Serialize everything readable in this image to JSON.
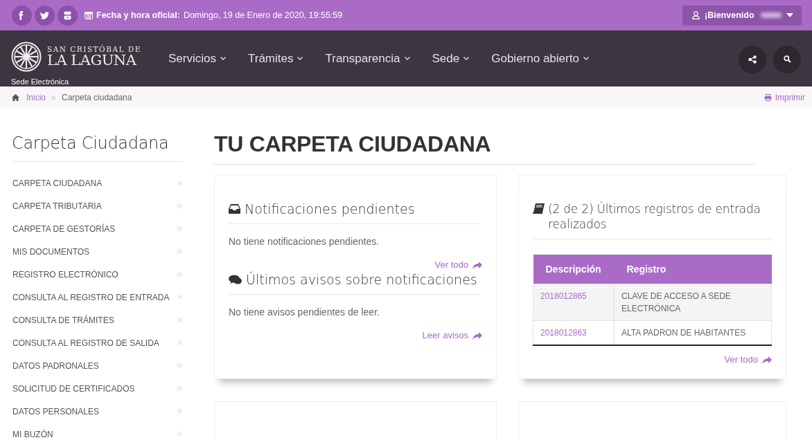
{
  "top_bar": {
    "date_label": "Fecha y hora oficial:",
    "date_value": "Domingo, 19 de Enero de 2020, 19:55:59",
    "user_button": "¡Bienvenido"
  },
  "header": {
    "logo_line_1": "SAN CRISTÓBAL DE",
    "logo_line_2": "LA LAGUNA",
    "subtitle": "Sede Electrónica",
    "nav": [
      "Servicios",
      "Trámites",
      "Transparencia",
      "Sede",
      "Gobierno abierto"
    ]
  },
  "breadcrumb": {
    "items": [
      "Inicio",
      "Carpeta ciudadana"
    ],
    "print": "Imprimir"
  },
  "sidebar": {
    "title": "Carpeta Ciudadana",
    "items": [
      "CARPETA CIUDADANA",
      "CARPETA TRIBUTARIA",
      "CARPETA DE GESTORÍAS",
      "MIS DOCUMENTOS",
      "REGISTRO ELECTRÓNICO",
      "CONSULTA AL REGISTRO DE ENTRADA",
      "CONSULTA DE TRÁMITES",
      "CONSULTA AL REGISTRO DE SALIDA",
      "DATOS PADRONALES",
      "SOLICITUD DE CERTIFICADOS",
      "DATOS PERSONALES",
      "MI BUZÓN"
    ]
  },
  "main": {
    "title": "TU CARPETA CIUDADANA",
    "notifications_card": {
      "sections": [
        {
          "kind": "inbox",
          "title": "Notificaciones pendientes",
          "message": "No tiene notificaciones pendientes.",
          "link": "Ver todo"
        },
        {
          "kind": "chat",
          "title": "Últimos avisos sobre notificaciones",
          "message": "No tiene avisos pendientes de leer.",
          "link": "Leer avisos"
        }
      ]
    },
    "registry_card": {
      "title": "(2 de 2) Últimos registros de entrada realizados",
      "columns": [
        "Descripción",
        "Registro"
      ],
      "rows": [
        [
          "2018012865",
          "CLAVE DE ACCESO A SEDE ELECTRÓNICA"
        ],
        [
          "2018012863",
          "ALTA PADRON DE HABITANTES"
        ]
      ],
      "link": "Ver todo"
    }
  }
}
